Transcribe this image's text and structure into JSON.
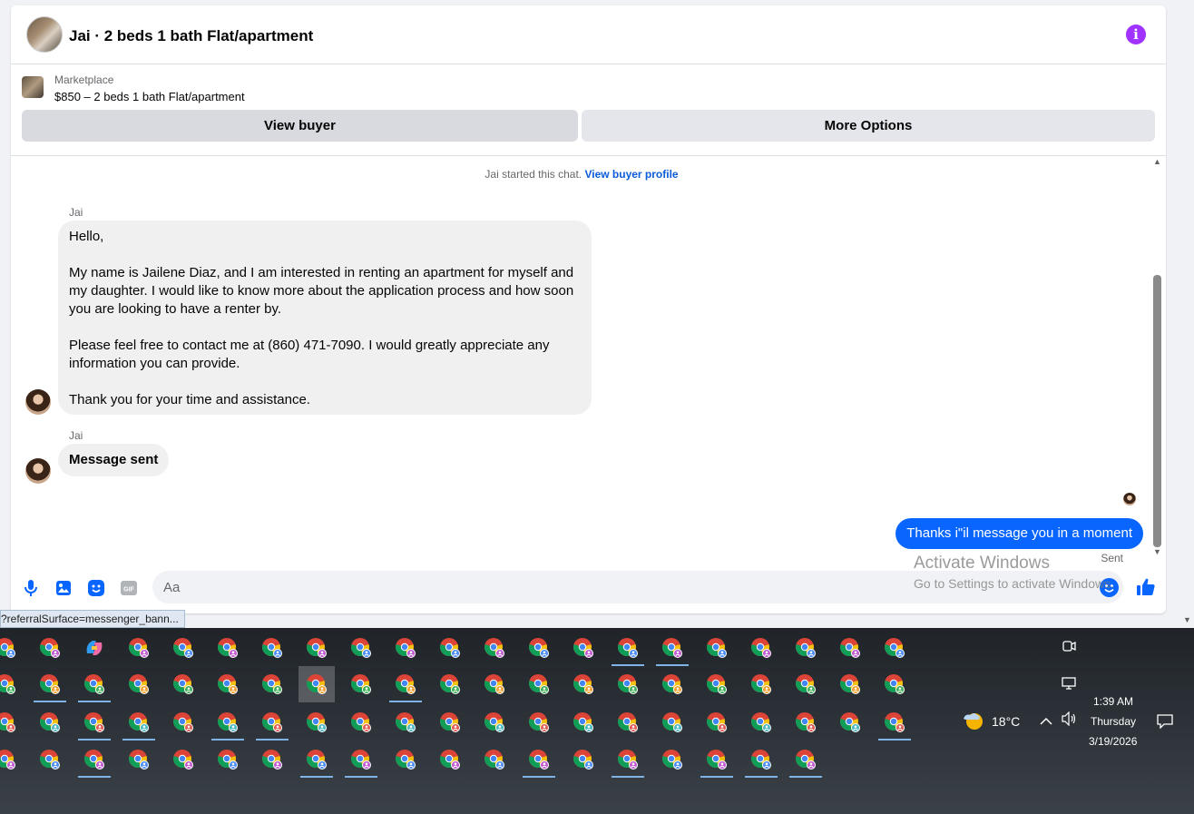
{
  "header": {
    "title": "Jai · 2 beds 1 bath Flat/apartment"
  },
  "listing": {
    "source": "Marketplace",
    "title": "$850 – 2 beds 1 bath Flat/apartment",
    "view_buyer_label": "View buyer",
    "more_options_label": "More Options"
  },
  "thread": {
    "system_text": "Jai started this chat.",
    "system_link": "View buyer profile",
    "messages": [
      {
        "sender": "Jai",
        "paragraphs": [
          "Hello,",
          "My name is Jailene Diaz, and I am interested in renting an apartment for myself and my daughter. I would like to know more about the application process and how soon you are looking to have a renter by.",
          "Please feel free to contact me at (860) 471-7090. I would greatly appreciate any information you can provide.",
          "Thank you for your time and assistance."
        ]
      },
      {
        "sender": "Jai",
        "text": "Message sent"
      }
    ],
    "outgoing": {
      "text": "Thanks i\"il message you in a moment",
      "status": "Sent"
    }
  },
  "composer": {
    "placeholder": "Aa"
  },
  "watermark": {
    "title": "Activate Windows",
    "subtitle": "Go to Settings to activate Windows."
  },
  "status_bar": {
    "url": "?referralSurface=messenger_bann..."
  },
  "taskbar": {
    "weather": "18°C",
    "time": "1:39 AM",
    "day": "Thursday",
    "date": "3/19/2026"
  },
  "colors": {
    "accent": "#0866ff",
    "info": "#a033ff",
    "taskbar": "#2c3238"
  }
}
